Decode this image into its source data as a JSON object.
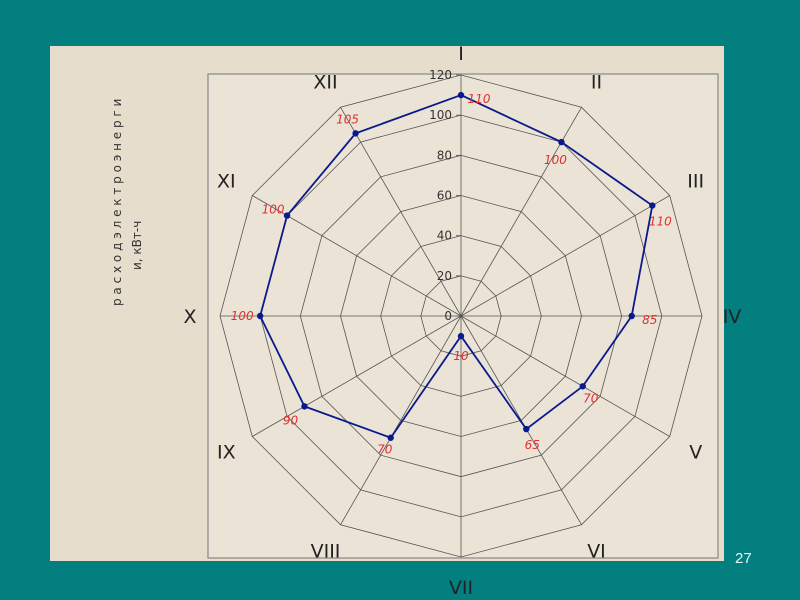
{
  "chart_data": {
    "type": "radar",
    "title": "",
    "ylabel": "расход электроэнергии, кВт-ч",
    "ylabel_line1": "р а с х о д   э л е к т р о э н е р г и",
    "ylabel_line2": "и, кВт-ч",
    "categories": [
      "I",
      "II",
      "III",
      "IV",
      "V",
      "VI",
      "VII",
      "VIII",
      "IX",
      "X",
      "XI",
      "XII"
    ],
    "values": [
      110,
      100,
      110,
      85,
      70,
      65,
      10,
      70,
      90,
      100,
      100,
      105
    ],
    "data_labels": [
      "110",
      "100",
      "110",
      "85",
      "70",
      "65",
      "10",
      "70",
      "90",
      "100",
      "100",
      "105"
    ],
    "rlim": [
      0,
      120
    ],
    "r_ticks": [
      "0",
      "20",
      "40",
      "60",
      "80",
      "100",
      "120"
    ],
    "r_tick_values": [
      0,
      20,
      40,
      60,
      80,
      100,
      120
    ],
    "grid": true,
    "series_color": "#0a1a8c",
    "label_color": "#e03030"
  },
  "page_number": "27"
}
